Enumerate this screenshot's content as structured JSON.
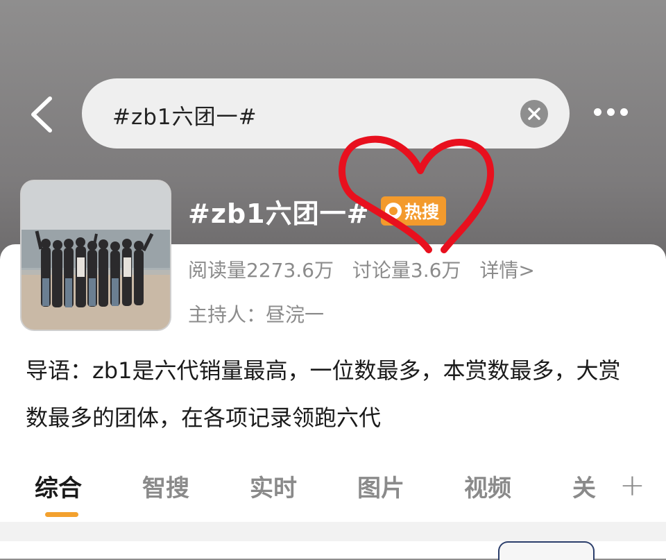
{
  "header": {
    "search_text": "#zb1六团一#",
    "clear_icon": "close-icon",
    "back_icon": "chevron-left-icon",
    "more_icon": "more-dots-icon"
  },
  "topic": {
    "title": "#zb1六团一#",
    "badge_label": "热搜",
    "badge_color": "#f39a2c",
    "reads": "阅读量2273.6万",
    "discussions": "讨论量3.6万",
    "details_link": "详情>",
    "host": "主持人：昼浣一"
  },
  "intro": {
    "text": "导语：zb1是六代销量最高，一位数最多，本赏数最多，大赏数最多的团体，在各项记录领跑六代"
  },
  "tabs": [
    {
      "label": "综合",
      "active": true
    },
    {
      "label": "智搜",
      "active": false
    },
    {
      "label": "实时",
      "active": false
    },
    {
      "label": "图片",
      "active": false
    },
    {
      "label": "视频",
      "active": false
    },
    {
      "label": "关",
      "active": false
    }
  ],
  "colors": {
    "accent": "#f3a12e",
    "annotation": "#e8101e"
  }
}
